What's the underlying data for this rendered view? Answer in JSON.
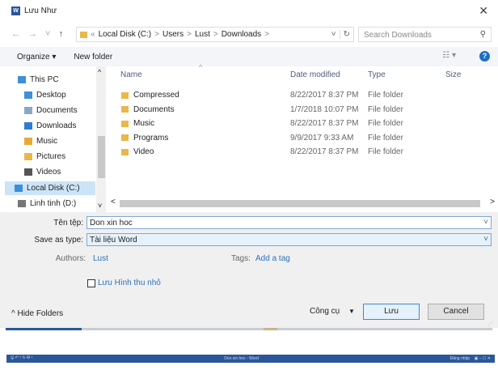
{
  "dialog": {
    "title": "Lưu Như",
    "app_icon": "word-icon"
  },
  "address": {
    "path": [
      "«",
      "Local Disk (C:)",
      ">",
      "Users",
      ">",
      "Lust",
      ">",
      "Downloads",
      ">"
    ],
    "search_placeholder": "Search Downloads"
  },
  "toolbar": {
    "organize": "Organize ▾",
    "new_folder": "New folder",
    "help": "?"
  },
  "sidebar": {
    "items": [
      {
        "label": "This PC",
        "icon": "computer-icon",
        "color": "#3d8fd8"
      },
      {
        "label": "Desktop",
        "icon": "desktop-icon",
        "color": "#3d8fd8"
      },
      {
        "label": "Documents",
        "icon": "documents-icon",
        "color": "#8aa7c8"
      },
      {
        "label": "Downloads",
        "icon": "downloads-icon",
        "color": "#2e7bd2"
      },
      {
        "label": "Music",
        "icon": "music-icon",
        "color": "#e8a93a"
      },
      {
        "label": "Pictures",
        "icon": "pictures-icon",
        "color": "#e8b84a"
      },
      {
        "label": "Videos",
        "icon": "videos-icon",
        "color": "#555"
      },
      {
        "label": "Local Disk (C:)",
        "icon": "drive-icon",
        "color": "#3d8fd8"
      },
      {
        "label": "Linh tinh (D:)",
        "icon": "drive-icon",
        "color": "#777"
      }
    ]
  },
  "columns": [
    "Name",
    "Date modified",
    "Type",
    "Size"
  ],
  "files": [
    {
      "name": "Compressed",
      "date": "8/22/2017 8:37 PM",
      "type": "File folder"
    },
    {
      "name": "Documents",
      "date": "1/7/2018 10:07 PM",
      "type": "File folder"
    },
    {
      "name": "Music",
      "date": "8/22/2017 8:37 PM",
      "type": "File folder"
    },
    {
      "name": "Programs",
      "date": "9/9/2017 9:33 AM",
      "type": "File folder"
    },
    {
      "name": "Video",
      "date": "8/22/2017 8:37 PM",
      "type": "File folder"
    }
  ],
  "form": {
    "filename_label": "Tên tệp:",
    "filename": "Don xin hoc",
    "savetype_label": "Save as type:",
    "savetype": "Tài liệu Word",
    "authors_label": "Authors:",
    "authors": "Lust",
    "tags_label": "Tags:",
    "tags": "Add a tag",
    "thumbnail_label": "Lưu Hình thu nhỏ",
    "thumbnail_checked": false
  },
  "footer": {
    "hide_folders": "^ Hide Folders",
    "tools": "Công cụ",
    "save": "Lưu",
    "cancel": "Cancel"
  },
  "word_bar": {
    "left": "🖫 ↶ ▾ ↻ ▤ ▾",
    "title": "Don xin hoc - Word",
    "signin": "Đăng nhập",
    "controls": "▣   –   ☐   ✕"
  }
}
